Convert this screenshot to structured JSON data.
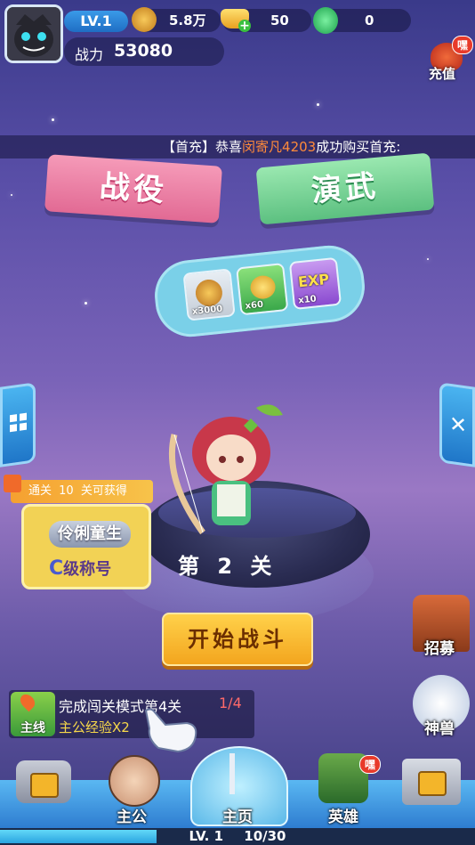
{
  "player": {
    "level": "LV.1",
    "power_label": "战力",
    "power_value": "53080"
  },
  "resources": {
    "coins": "5.8万",
    "gold": "50",
    "jade": "0"
  },
  "recharge": {
    "label": "充值",
    "badge": "嘿"
  },
  "marquee": {
    "prefix": "【首充】",
    "text1": "恭喜",
    "player_name": "闵寄凡4203",
    "text2": "成功购买首充:"
  },
  "modes": {
    "campaign": "战役",
    "practice": "演武"
  },
  "rewards": [
    {
      "name": "coin-reward-icon",
      "count": "x3000"
    },
    {
      "name": "wheat-reward-icon",
      "count": "x60"
    },
    {
      "name": "exp-reward-icon",
      "count": "x10",
      "tag": "EXP"
    }
  ],
  "clear_reward": {
    "prefix": "通关",
    "num": "10",
    "suffix": "关可获得",
    "title_name": "伶俐童生",
    "rank_letter": "C",
    "rank_text": "级称号"
  },
  "stage": {
    "label": "第 2 关"
  },
  "start_button": "开始战斗",
  "quest": {
    "tag": "主线",
    "title": "完成闯关模式第4关",
    "progress": "1/4",
    "reward": "主公经验X2"
  },
  "side_buttons": {
    "recruit": "招募",
    "beast": "神兽"
  },
  "nav": [
    {
      "label": "",
      "locked": true
    },
    {
      "label": "主公"
    },
    {
      "label": "主页"
    },
    {
      "label": "英雄",
      "badge": "嘿"
    },
    {
      "label": "",
      "locked": true
    }
  ],
  "exp_bar": {
    "level": "LV. 1",
    "progress": "10/30",
    "fraction": 0.33
  }
}
